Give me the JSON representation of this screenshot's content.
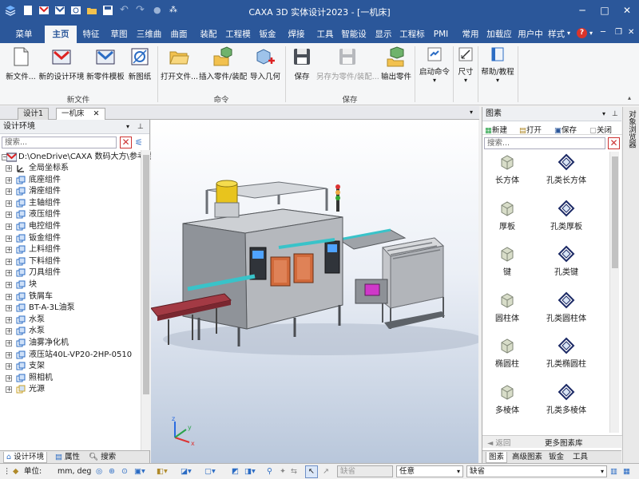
{
  "window": {
    "title": "CAXA 3D 实体设计2023 - [一机床]",
    "controls": [
      "─",
      "□",
      "✕"
    ]
  },
  "ribbon_tabs": [
    "菜单",
    "主页",
    "特征",
    "草图",
    "三维曲",
    "曲面",
    "装配",
    "工程模",
    "钣金",
    "焊接",
    "工具",
    "智能设",
    "显示",
    "工程标",
    "PMI",
    "常用",
    "加载应",
    "用户中"
  ],
  "ribbon_tabs_active": "主页",
  "ribbon_right": {
    "style_label": "样式",
    "help_icon": "?"
  },
  "ribbon": {
    "groups": [
      {
        "label": "新文件",
        "buttons": [
          "新文件...",
          "新的设计环境",
          "新零件模板",
          "新图纸"
        ]
      },
      {
        "label": "命令",
        "buttons": [
          "打开文件...",
          "插入零件/装配",
          "导入几何"
        ]
      },
      {
        "label": "保存",
        "buttons": [
          "保存",
          "另存为零件/装配...",
          "输出零件"
        ]
      }
    ],
    "extra_buttons": [
      "启动命令",
      "尺寸",
      "帮助/教程"
    ]
  },
  "doc_tabs": [
    "设计1",
    "一机床"
  ],
  "doc_tabs_active": "一机床",
  "left_pane": {
    "title": "设计环境",
    "search_placeholder": "搜索...",
    "root": "D:\\OneDrive\\CAXA 数码大方\\参考图",
    "items": [
      "全局坐标系",
      "底座组件",
      "滑座组件",
      "主轴组件",
      "液压组件",
      "电控组件",
      "钣金组件",
      "上料组件",
      "下料组件",
      "刀具组件",
      "块",
      "铁屑车",
      "BT-A-3L油泵",
      "水泵",
      "水泵",
      "油雾净化机",
      "液压站40L-VP20-2HP-0510",
      "支架",
      "照相机",
      "光源"
    ],
    "bottom_tabs": [
      "设计环境",
      "属性",
      "搜索"
    ]
  },
  "right_pane": {
    "title": "图素",
    "toolbar": [
      "新建",
      "打开",
      "保存",
      "关闭"
    ],
    "search_placeholder": "搜索...",
    "items": [
      "长方体",
      "孔类长方体",
      "厚板",
      "孔类厚板",
      "键",
      "孔类键",
      "圆柱体",
      "孔类圆柱体",
      "椭圆柱",
      "孔类椭圆柱",
      "多棱体",
      "孔类多棱体"
    ],
    "back_label": "返回",
    "more_label": "更多图素库",
    "bottom_tabs": [
      "图素",
      "高级图素",
      "钣金",
      "工具"
    ]
  },
  "side_strip_label": "对象浏览器",
  "status_bar": {
    "unit_label": "单位:",
    "unit_value": "mm, deg",
    "combo1": "缺省",
    "combo2": "任意",
    "combo3": "缺省"
  },
  "colors": {
    "title_blue": "#2b579a",
    "machine_gray": "#8f9399",
    "cabinet_orange": "#d16a3b",
    "conveyor_red": "#a33a44",
    "accent_cyan": "#39c3c9",
    "oil_yellow": "#e8c41d"
  }
}
